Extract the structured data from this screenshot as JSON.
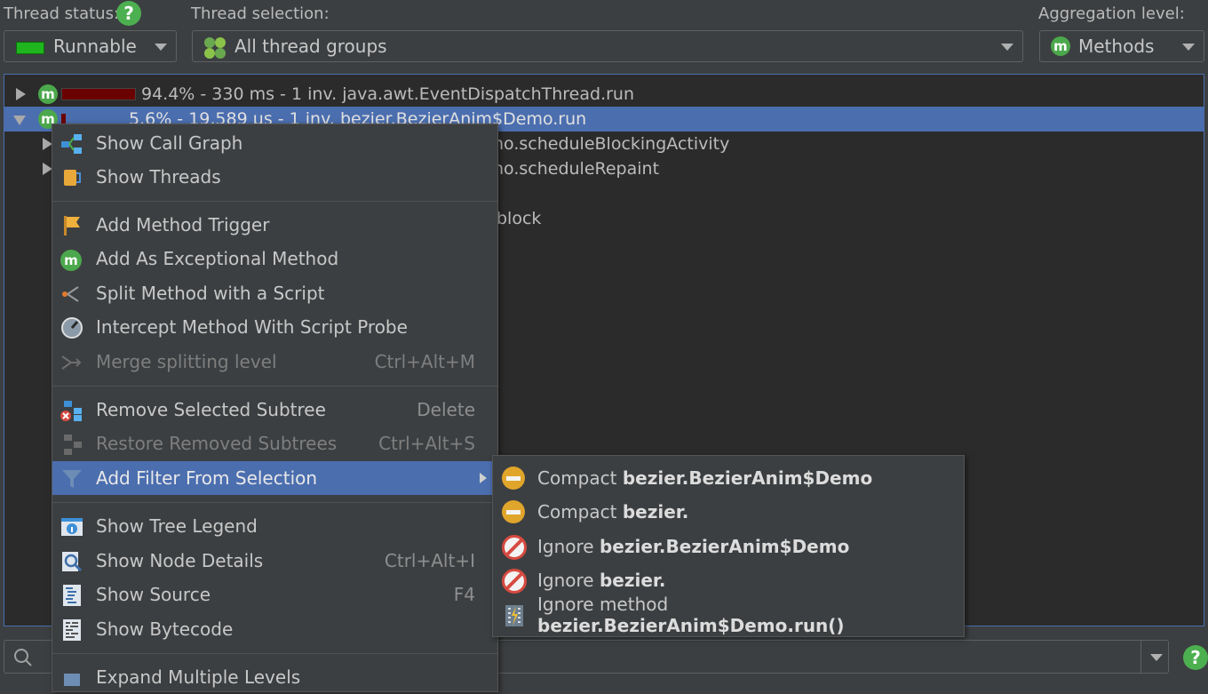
{
  "toolbar": {
    "thread_status_label": "Thread status:",
    "thread_status_value": "Runnable",
    "thread_selection_label": "Thread selection:",
    "thread_selection_value": "All thread groups",
    "aggregation_label": "Aggregation level:",
    "aggregation_value": "Methods",
    "status_color": "#1fb51f"
  },
  "tree": {
    "rows": [
      {
        "text": "94.4% - 330 ms - 1 inv. java.awt.EventDispatchThread.run",
        "percent": 94.4
      },
      {
        "text": "5.6% - 19,589 µs - 1 inv. bezier.BezierAnim$Demo.run",
        "percent": 5.6
      },
      {
        "text": "no.scheduleBlockingActivity"
      },
      {
        "text": "no.scheduleRepaint"
      },
      {
        "text": "block"
      }
    ]
  },
  "context_menu": {
    "items": [
      {
        "label": "Show Call Graph",
        "icon": "call-graph-icon"
      },
      {
        "label": "Show Threads",
        "icon": "threads-icon"
      },
      {
        "label": "Add Method Trigger",
        "icon": "flag-icon"
      },
      {
        "label": "Add As Exceptional Method",
        "icon": "exceptional-method-icon"
      },
      {
        "label": "Split Method with a Script",
        "icon": "split-icon"
      },
      {
        "label": "Intercept Method With Script Probe",
        "icon": "probe-icon"
      },
      {
        "label": "Merge splitting level",
        "shortcut": "Ctrl+Alt+M",
        "icon": "merge-icon",
        "disabled": true
      },
      {
        "label": "Remove Selected Subtree",
        "shortcut": "Delete",
        "icon": "remove-subtree-icon"
      },
      {
        "label": "Restore Removed Subtrees",
        "shortcut": "Ctrl+Alt+S",
        "icon": "restore-icon",
        "disabled": true
      },
      {
        "label": "Add Filter From Selection",
        "icon": "filter-icon",
        "highlighted": true
      },
      {
        "label": "Show Tree Legend",
        "icon": "legend-icon"
      },
      {
        "label": "Show Node Details",
        "shortcut": "Ctrl+Alt+I",
        "icon": "node-details-icon"
      },
      {
        "label": "Show Source",
        "shortcut": "F4",
        "icon": "source-icon"
      },
      {
        "label": "Show Bytecode",
        "icon": "bytecode-icon"
      },
      {
        "label": "Expand Multiple Levels",
        "icon": "expand-icon"
      }
    ]
  },
  "submenu": {
    "items": [
      {
        "prefix": "Compact ",
        "bold": "bezier.BezierAnim$Demo",
        "icon": "compact-icon"
      },
      {
        "prefix": "Compact ",
        "bold": "bezier.",
        "icon": "compact-icon"
      },
      {
        "prefix": "Ignore ",
        "bold": "bezier.BezierAnim$Demo",
        "icon": "ignore-icon"
      },
      {
        "prefix": "Ignore ",
        "bold": "bezier.",
        "icon": "ignore-icon"
      },
      {
        "prefix": "Ignore method ",
        "bold": "bezier.BezierAnim$Demo.run()",
        "icon": "ignore-method-icon"
      }
    ]
  },
  "colors": {
    "selection": "#4b6eaf",
    "background": "#3c3f41",
    "tree_background": "#2b2b2b",
    "bar": "#6b0000"
  }
}
